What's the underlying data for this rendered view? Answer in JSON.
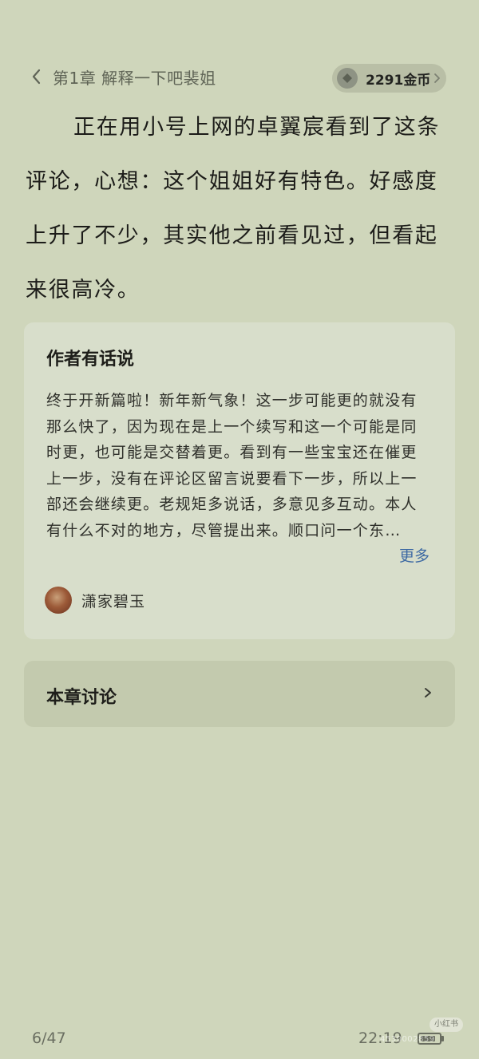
{
  "header": {
    "chapter_title": "第1章 解释一下吧裴姐",
    "coin_balance": "2291金币"
  },
  "content": {
    "body_text": "正在用小号上网的卓翼宸看到了这条评论，心想：这个姐姐好有特色。好感度上升了不少，其实他之前看见过，但看起来很高冷。"
  },
  "author_note": {
    "title": "作者有话说",
    "text": "终于开新篇啦！新年新气象！这一步可能更的就没有那么快了，因为现在是上一个续写和这一个可能是同时更，也可能是交替着更。看到有一些宝宝还在催更上一步，没有在评论区留言说要看下一步，所以上一部还会继续更。老规矩多说话，多意见多互动。本人有什么不对的地方，尽管提出来。顺口问一个东…",
    "more_label": "更多",
    "author_name": "潇家碧玉"
  },
  "discussion": {
    "label": "本章讨论"
  },
  "footer": {
    "page_indicator": "6/47",
    "time": "22:19",
    "battery_level": 0.8
  },
  "watermark": {
    "badge": "小红书",
    "id": "4530002859"
  },
  "colors": {
    "background": "#cfd6bb",
    "card": "#d8decb",
    "discussion_card": "#c3caae",
    "link": "#3e6aa3",
    "coin_pill": "#b9bfa6"
  },
  "icons": {
    "back": "chevron-left-icon",
    "coin": "coin-icon",
    "coin_arrow": "chevron-right-icon",
    "discussion_arrow": "chevron-right-icon",
    "battery": "battery-icon"
  }
}
